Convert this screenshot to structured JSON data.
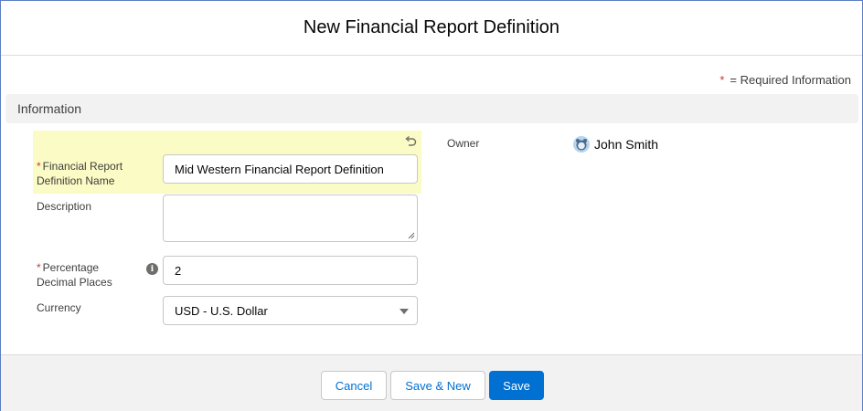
{
  "modal": {
    "title": "New Financial Report Definition",
    "required_note_star": "*",
    "required_note_text": "= Required Information"
  },
  "section": {
    "title": "Information"
  },
  "fields": {
    "name": {
      "required_star": "*",
      "label_line1": "Financial Report",
      "label_line2": "Definition Name",
      "value": "Mid Western Financial Report Definition"
    },
    "description": {
      "label": "Description",
      "value": ""
    },
    "decimal_places": {
      "required_star": "*",
      "label_line1": "Percentage",
      "label_line2": "Decimal Places",
      "value": "2",
      "help_icon": "info-icon"
    },
    "currency": {
      "label": "Currency",
      "value": "USD - U.S. Dollar"
    }
  },
  "owner": {
    "label": "Owner",
    "name": "John Smith"
  },
  "footer": {
    "cancel_label": "Cancel",
    "save_new_label": "Save & New",
    "save_label": "Save"
  },
  "colors": {
    "brand": "#0070d2",
    "required": "#c23934",
    "highlight": "#fbfbc6"
  }
}
